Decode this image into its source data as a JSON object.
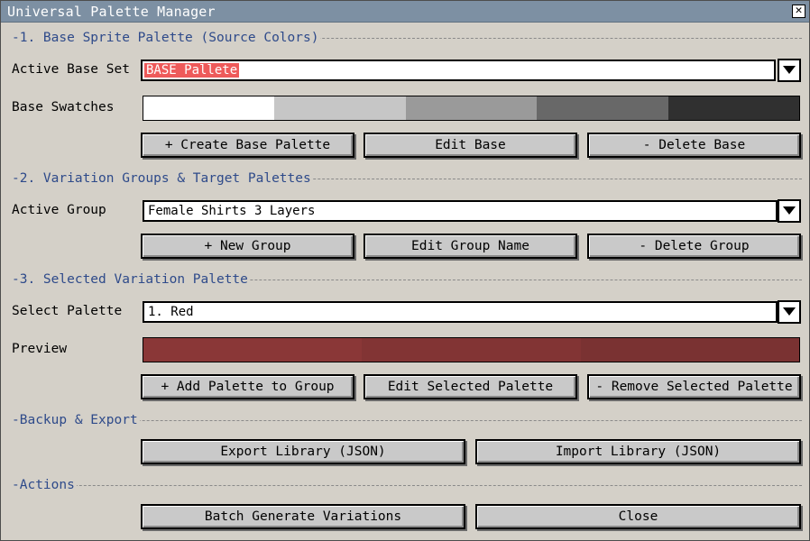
{
  "window": {
    "title": "Universal Palette Manager"
  },
  "sections": {
    "base": "-1. Base Sprite Palette (Source Colors)",
    "variation": "-2. Variation Groups & Target Palettes",
    "selected": "-3. Selected Variation Palette",
    "backup": "-Backup & Export",
    "actions": "-Actions"
  },
  "base": {
    "active_label": "Active Base Set",
    "active_value": "BASE Pallete",
    "swatches_label": "Base Swatches",
    "swatches": [
      "#ffffff",
      "#c6c6c6",
      "#9a9a9a",
      "#686868",
      "#303030"
    ],
    "create_button": "+ Create Base Palette",
    "edit_button": "Edit Base",
    "delete_button": "- Delete Base"
  },
  "group": {
    "active_label": "Active Group",
    "active_value": "Female Shirts 3 Layers",
    "new_button": "+ New Group",
    "edit_button": "Edit Group Name",
    "delete_button": "- Delete Group"
  },
  "palette": {
    "select_label": "Select Palette",
    "select_value": "1. Red",
    "preview_label": "Preview",
    "preview_colors": [
      "#8a3737",
      "#823434",
      "#7a3232"
    ],
    "add_button": "+ Add Palette to Group",
    "edit_button": "Edit Selected Palette",
    "remove_button": "- Remove Selected Palette"
  },
  "backup": {
    "export_button": "Export Library (JSON)",
    "import_button": "Import Library (JSON)"
  },
  "actions": {
    "batch_button": "Batch Generate Variations",
    "close_button": "Close"
  }
}
